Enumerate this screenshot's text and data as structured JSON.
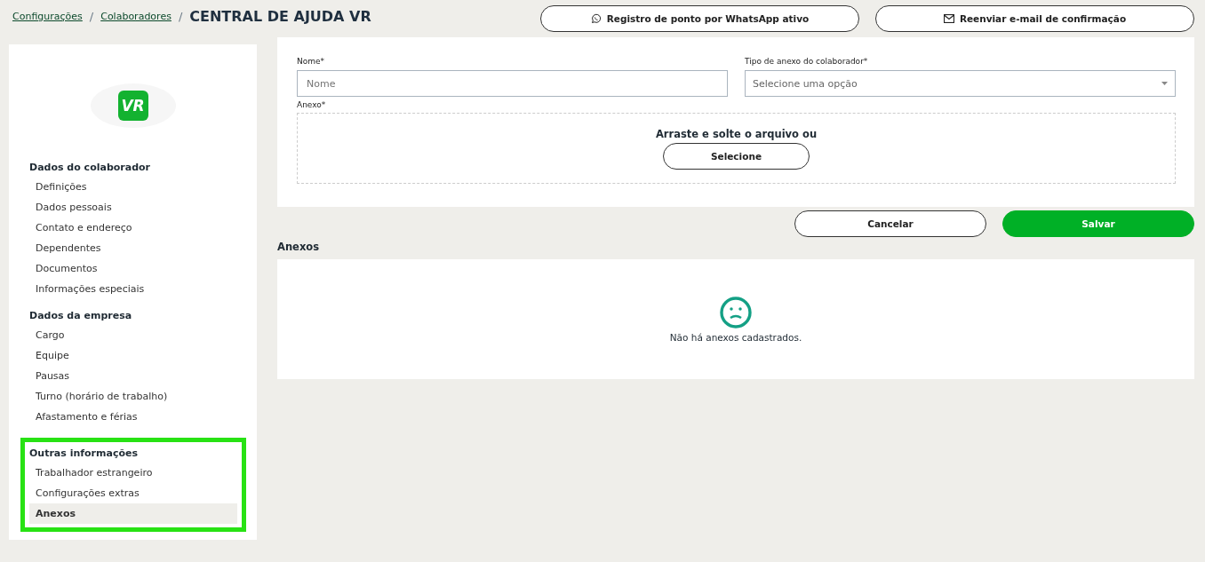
{
  "breadcrumb": {
    "links": [
      "Configurações",
      "Colaboradores"
    ],
    "separator": "/",
    "title": "CENTRAL DE AJUDA VR"
  },
  "header_buttons": [
    {
      "kind": "whatsapp",
      "label": "Registro de ponto por WhatsApp ativo"
    },
    {
      "kind": "mail",
      "label": "Reenviar e-mail de confirmação"
    }
  ],
  "sidebar": {
    "logo": {
      "text": "VR"
    },
    "sections": [
      {
        "title": "Dados do colaborador",
        "highlighted": false,
        "items": [
          {
            "label": "Definições",
            "selected": false
          },
          {
            "label": "Dados pessoais",
            "selected": false
          },
          {
            "label": "Contato e endereço",
            "selected": false
          },
          {
            "label": "Dependentes",
            "selected": false
          },
          {
            "label": "Documentos",
            "selected": false
          },
          {
            "label": "Informações especiais",
            "selected": false
          }
        ]
      },
      {
        "title": "Dados da empresa",
        "highlighted": false,
        "items": [
          {
            "label": "Cargo",
            "selected": false
          },
          {
            "label": "Equipe",
            "selected": false
          },
          {
            "label": "Pausas",
            "selected": false
          },
          {
            "label": "Turno (horário de trabalho)",
            "selected": false
          },
          {
            "label": "Afastamento e férias",
            "selected": false
          }
        ]
      },
      {
        "title": "Outras informações",
        "highlighted": true,
        "items": [
          {
            "label": "Trabalhador estrangeiro",
            "selected": false
          },
          {
            "label": "Configurações extras",
            "selected": false
          },
          {
            "label": "Anexos",
            "selected": true
          }
        ]
      }
    ]
  },
  "form": {
    "name_field": {
      "label": "Nome*",
      "placeholder": "Nome"
    },
    "type_field": {
      "label": "Tipo de anexo do colaborador*",
      "placeholder": "Selecione uma opção"
    },
    "attachment": {
      "label": "Anexo*",
      "prompt": "Arraste e solte o arquivo ou",
      "button": "Selecione"
    }
  },
  "actions": [
    {
      "kind": "secondary",
      "label": "Cancelar"
    },
    {
      "kind": "primary",
      "label": "Salvar"
    }
  ],
  "attachments": {
    "title": "Anexos",
    "empty_message": "Não há anexos cadastrados."
  }
}
